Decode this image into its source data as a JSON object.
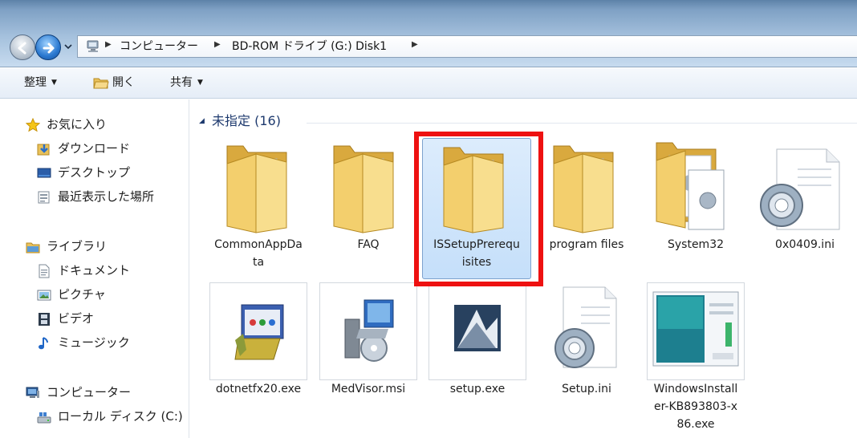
{
  "address_bar": {
    "crumbs": [
      "コンピューター",
      "BD-ROM ドライブ (G:) Disk1"
    ]
  },
  "toolbar": {
    "organize_label": "整理",
    "open_label": "開く",
    "share_label": "共有"
  },
  "nav_pane": {
    "favorites": [
      {
        "label": "お気に入り",
        "icon": "star-icon"
      },
      {
        "label": "ダウンロード",
        "icon": "download-folder-icon"
      },
      {
        "label": "デスクトップ",
        "icon": "desktop-icon"
      },
      {
        "label": "最近表示した場所",
        "icon": "recent-places-icon"
      }
    ],
    "libraries": [
      {
        "label": "ライブラリ",
        "icon": "library-icon"
      },
      {
        "label": "ドキュメント",
        "icon": "document-icon"
      },
      {
        "label": "ピクチャ",
        "icon": "picture-icon"
      },
      {
        "label": "ビデオ",
        "icon": "video-icon"
      },
      {
        "label": "ミュージック",
        "icon": "music-icon"
      }
    ],
    "computer": [
      {
        "label": "コンピューター",
        "icon": "computer-icon"
      },
      {
        "label": "ローカル ディスク (C:)",
        "icon": "local-disk-icon"
      }
    ]
  },
  "content": {
    "group_header": "未指定 (16)",
    "files": [
      {
        "name": "CommonAppData",
        "display": "CommonAppDa\nta",
        "icon": "folder-icon"
      },
      {
        "name": "FAQ",
        "display": "FAQ",
        "icon": "folder-icon"
      },
      {
        "name": "ISSetupPrerequisites",
        "display": "ISSetupPrerequ\nisites",
        "icon": "folder-icon",
        "selected": true
      },
      {
        "name": "program files",
        "display": "program files",
        "icon": "folder-icon"
      },
      {
        "name": "System32",
        "display": "System32",
        "icon": "folder-icon"
      },
      {
        "name": "0x0409.ini",
        "display": "0x0409.ini",
        "icon": "config-file-icon"
      },
      {
        "name": "dotnetfx20.exe",
        "display": "dotnetfx20.exe",
        "icon": "installer-box-icon"
      },
      {
        "name": "MedVisor.msi",
        "display": "MedVisor.msi",
        "icon": "msi-package-icon"
      },
      {
        "name": "setup.exe",
        "display": "setup.exe",
        "icon": "setup-app-icon"
      },
      {
        "name": "Setup.ini",
        "display": "Setup.ini",
        "icon": "config-file-icon"
      },
      {
        "name": "WindowsInstaller-KB893803-x86.exe",
        "display": "WindowsInstall\ner-KB893803-x\n86.exe",
        "icon": "windows-installer-icon"
      }
    ]
  },
  "colors": {
    "highlight_box": "#ee1111",
    "selection_fill": "#cfe4fb",
    "group_header_text": "#1e3a6e"
  }
}
